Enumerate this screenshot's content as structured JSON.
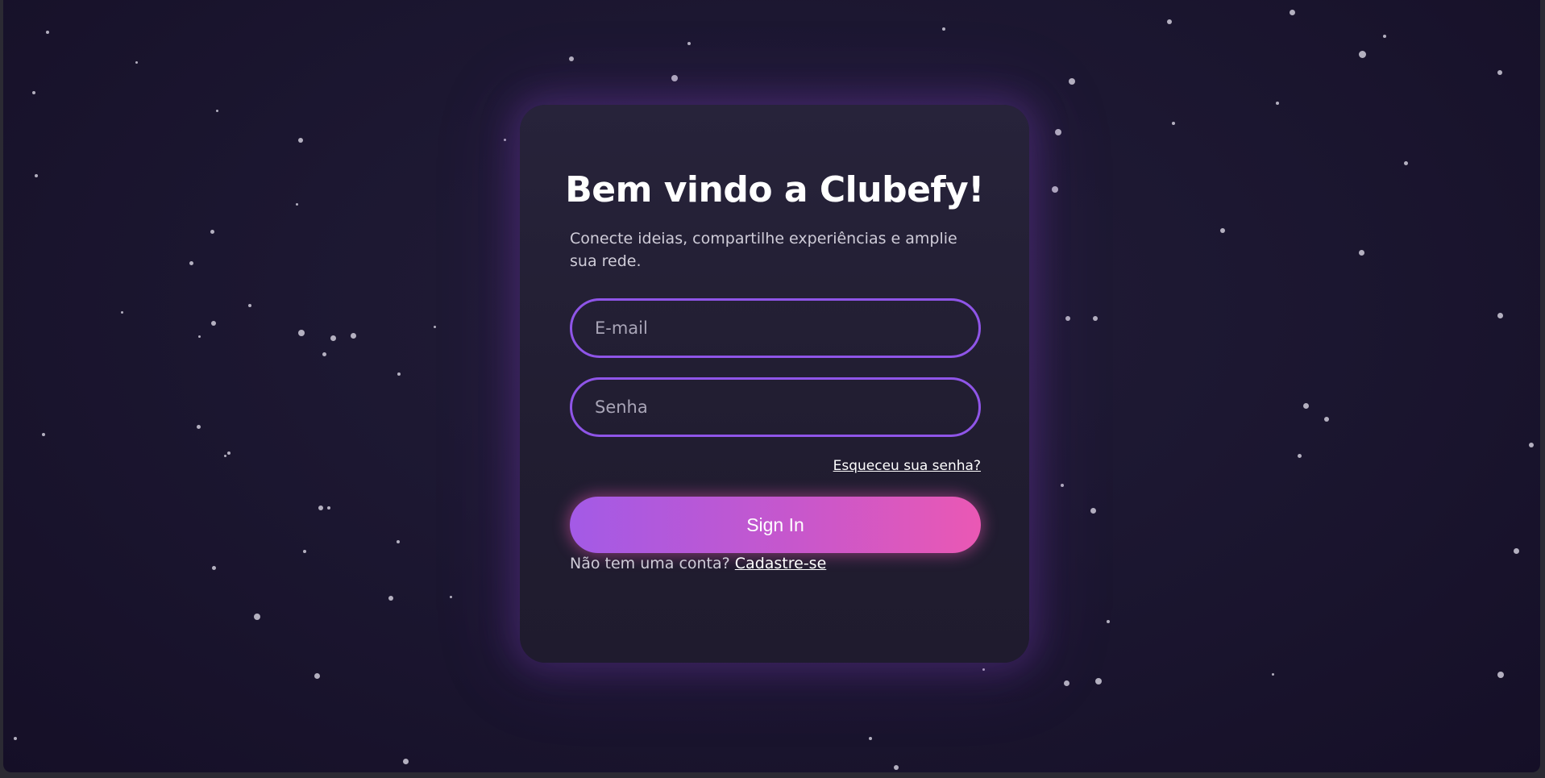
{
  "login": {
    "title": "Bem vindo a Clubefy!",
    "subtitle": "Conecte ideias, compartilhe experiências e amplie sua rede.",
    "email_placeholder": "E-mail",
    "password_placeholder": "Senha",
    "forgot_password": "Esqueceu sua senha?",
    "sign_in_label": "Sign In",
    "no_account_text": "Não tem uma conta? ",
    "sign_up_link": "Cadastre-se"
  },
  "colors": {
    "background": "#1c1731",
    "card": "#231f35",
    "input_border": "#8f55e8",
    "button_gradient_start": "#a35ae6",
    "button_gradient_end": "#ea58b4",
    "text_primary": "#ffffff",
    "text_secondary": "#cfccd8"
  }
}
